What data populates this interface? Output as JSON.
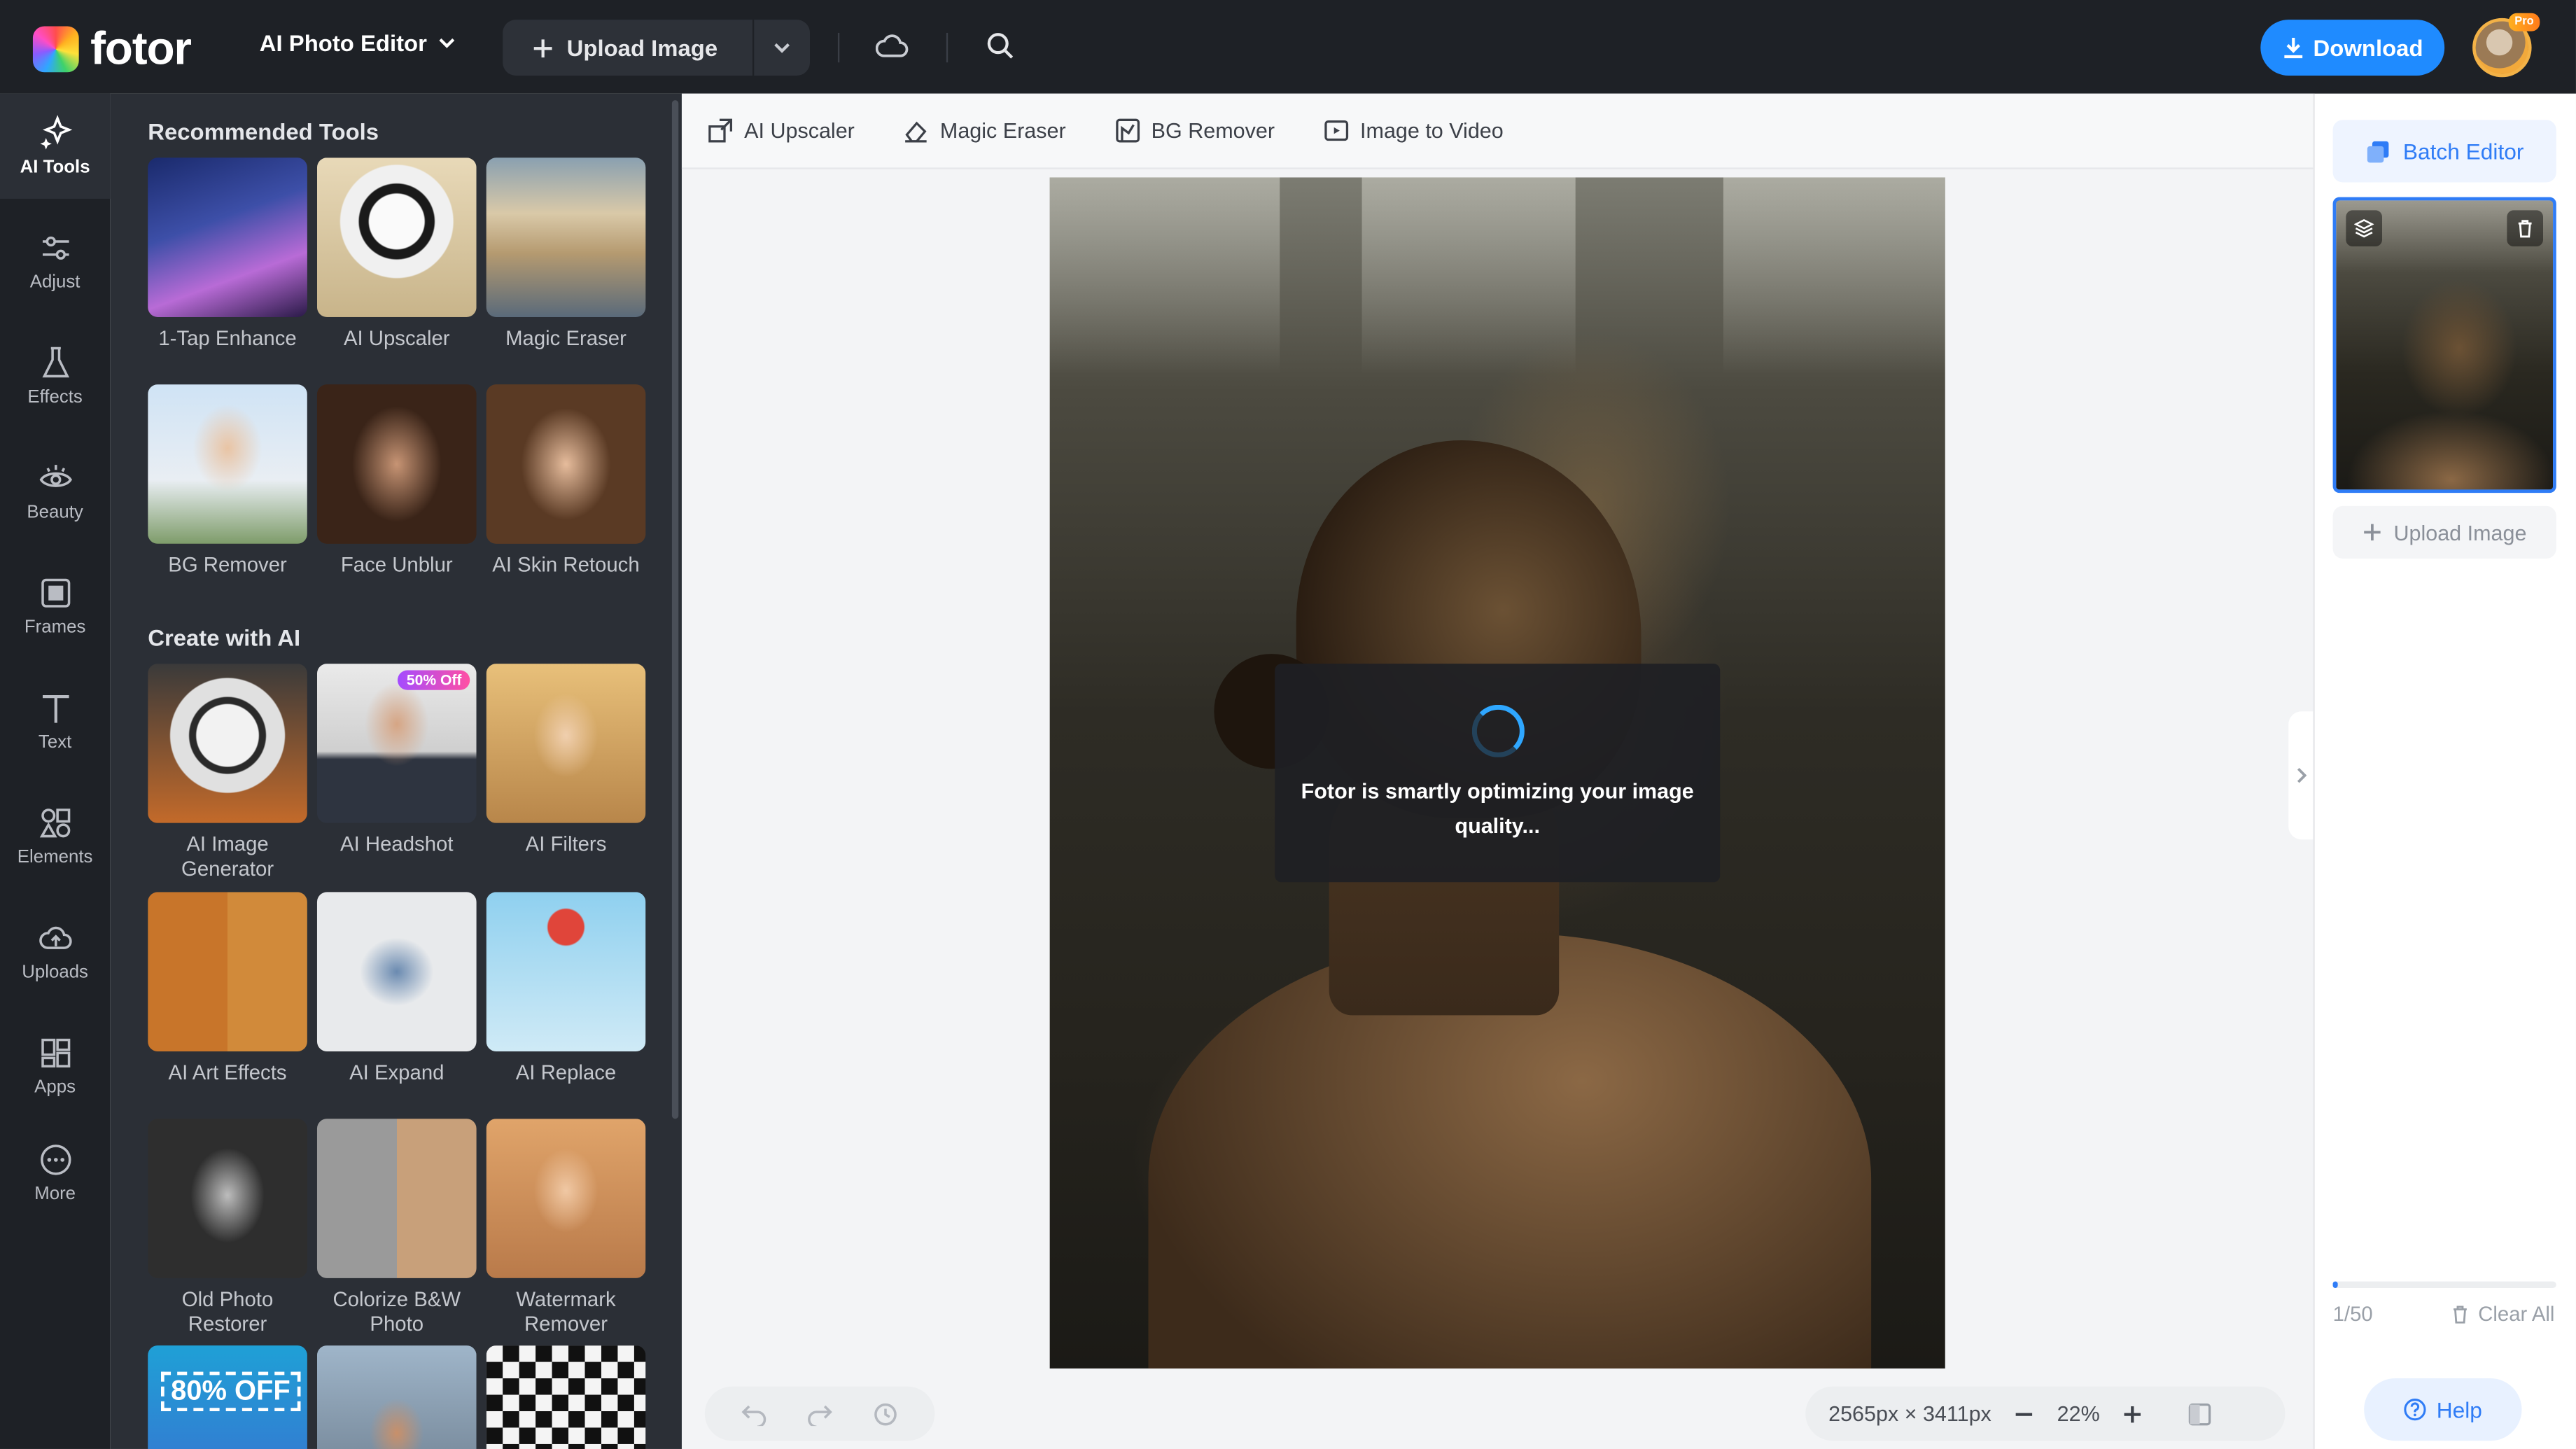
{
  "topbar": {
    "logo_text": "fotor",
    "editor_menu": "AI Photo Editor",
    "upload_label": "Upload Image",
    "download_label": "Download",
    "pro_badge": "Pro",
    "accent": "#1f8bff"
  },
  "rail": {
    "items": [
      {
        "label": "AI Tools",
        "icon": "sparkle-icon"
      },
      {
        "label": "Adjust",
        "icon": "sliders-icon"
      },
      {
        "label": "Effects",
        "icon": "flask-icon"
      },
      {
        "label": "Beauty",
        "icon": "eye-icon"
      },
      {
        "label": "Frames",
        "icon": "frame-icon"
      },
      {
        "label": "Text",
        "icon": "text-icon"
      },
      {
        "label": "Elements",
        "icon": "shapes-icon"
      },
      {
        "label": "Uploads",
        "icon": "cloud-upload-icon"
      },
      {
        "label": "Apps",
        "icon": "apps-icon"
      },
      {
        "label": "More",
        "icon": "more-icon"
      }
    ]
  },
  "panel": {
    "recommended_title": "Recommended Tools",
    "recommended": [
      {
        "label": "1-Tap Enhance"
      },
      {
        "label": "AI Upscaler"
      },
      {
        "label": "Magic Eraser"
      },
      {
        "label": "BG Remover"
      },
      {
        "label": "Face Unblur"
      },
      {
        "label": "AI Skin Retouch"
      }
    ],
    "create_title": "Create with AI",
    "create": [
      {
        "label": "AI Image Generator"
      },
      {
        "label": "AI Headshot",
        "badge": "50% Off"
      },
      {
        "label": "AI Filters"
      },
      {
        "label": "AI Art Effects"
      },
      {
        "label": "AI Expand"
      },
      {
        "label": "AI Replace"
      },
      {
        "label": "Old Photo Restorer"
      },
      {
        "label": "Colorize B&W Photo"
      },
      {
        "label": "Watermark Remover"
      }
    ],
    "promo_text": "80% OFF"
  },
  "toolbar": {
    "items": [
      {
        "label": "AI Upscaler",
        "icon": "upscale-icon"
      },
      {
        "label": "Magic Eraser",
        "icon": "eraser-icon"
      },
      {
        "label": "BG Remover",
        "icon": "bg-remove-icon"
      },
      {
        "label": "Image to Video",
        "icon": "video-icon"
      }
    ]
  },
  "canvas": {
    "loading_text": "Fotor is smartly optimizing your image quality...",
    "dimensions": "2565px × 3411px",
    "zoom": "22%"
  },
  "right_panel": {
    "batch_label": "Batch Editor",
    "upload_label": "Upload Image",
    "count": "1/50",
    "progress_fraction": 0.02,
    "clear_label": "Clear All",
    "help_label": "Help"
  }
}
